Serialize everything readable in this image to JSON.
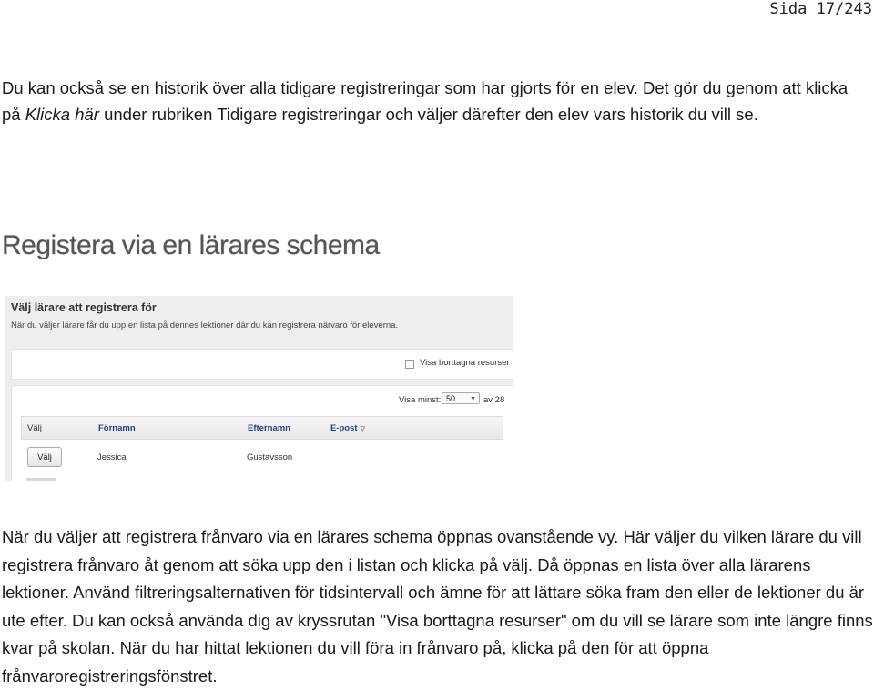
{
  "page_number": "Sida 17/243",
  "intro": {
    "before": "Du kan också se en historik över alla tidigare registreringar som har gjorts för en elev. Det gör du genom att klicka på ",
    "link_italic": "Klicka här",
    "after": " under rubriken Tidigare registreringar och väljer därefter den elev vars historik du vill se."
  },
  "heading": "Registera via en lärares schema",
  "screenshot": {
    "title": "Välj lärare att registrera för",
    "subtitle": "När du väljer lärare får du upp en lista på dennes lektioner där du kan registrera närvaro för eleverna.",
    "show_removed_label": "Visa borttagna resurser",
    "show_min_label": "Visa minst:",
    "show_min_value": "50",
    "count_label": "av 28",
    "columns": [
      "Välj",
      "Förnamn",
      "Efternamn",
      "E-post"
    ],
    "rows": [
      {
        "button": "Välj",
        "first_name": "Jessica",
        "last_name": "Gustavsson"
      }
    ]
  },
  "body_text": "När du väljer att registrera frånvaro via en lärares schema öppnas ovanstående vy. Här väljer du vilken lärare du vill registrera frånvaro åt genom att söka upp den i listan och klicka på välj. Då öppnas en lista över alla lärarens lektioner. Använd filtreringsalternativen för tidsintervall och ämne för att lättare söka fram den eller de lektioner du är ute efter. Du kan också använda dig av kryssrutan \"Visa borttagna resurser\" om du vill se lärare som inte längre finns kvar på skolan. När du har hittat lektionen du vill föra in frånvaro på, klicka på den för att öppna frånvaroregistreringsfönstret.",
  "icons": {
    "sort": "sort-arrow-icon",
    "dropdown": "chevron-down-icon"
  }
}
